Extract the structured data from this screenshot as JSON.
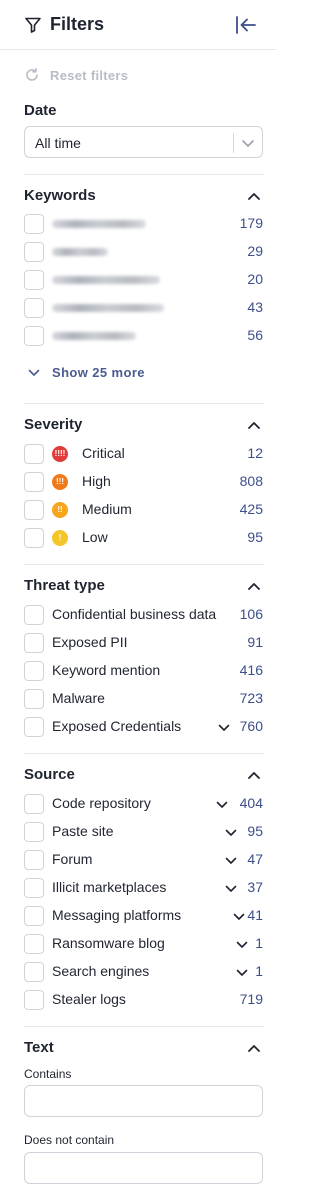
{
  "header": {
    "title": "Filters",
    "filter_icon": "filter-icon",
    "collapse_icon": "collapse-left-icon"
  },
  "reset": {
    "label": "Reset filters",
    "icon": "refresh-icon"
  },
  "date": {
    "title": "Date",
    "value": "All time"
  },
  "keywords": {
    "title": "Keywords",
    "items": [
      {
        "label": "",
        "count": "179"
      },
      {
        "label": "",
        "count": "29"
      },
      {
        "label": "",
        "count": "20"
      },
      {
        "label": "",
        "count": "43"
      },
      {
        "label": "",
        "count": "56"
      }
    ],
    "show_more": "Show 25 more"
  },
  "severity": {
    "title": "Severity",
    "items": [
      {
        "label": "Critical",
        "count": "12",
        "color": "#e23b3b",
        "icon": "!!!!"
      },
      {
        "label": "High",
        "count": "808",
        "color": "#f07a1a",
        "icon": "!!!"
      },
      {
        "label": "Medium",
        "count": "425",
        "color": "#f6a51c",
        "icon": "!!"
      },
      {
        "label": "Low",
        "count": "95",
        "color": "#f5c62a",
        "icon": "!"
      }
    ]
  },
  "threat_type": {
    "title": "Threat type",
    "items": [
      {
        "label": "Confidential business data",
        "count": "106"
      },
      {
        "label": "Exposed PII",
        "count": "91"
      },
      {
        "label": "Keyword mention",
        "count": "416"
      },
      {
        "label": "Malware",
        "count": "723"
      },
      {
        "label": "Exposed Credentials",
        "count": "760"
      }
    ]
  },
  "source": {
    "title": "Source",
    "items": [
      {
        "label": "Code repository",
        "count": "404"
      },
      {
        "label": "Paste site",
        "count": "95"
      },
      {
        "label": "Forum",
        "count": "47"
      },
      {
        "label": "Illicit marketplaces",
        "count": "37"
      },
      {
        "label": "Messaging platforms",
        "count": "41"
      },
      {
        "label": "Ransomware blog",
        "count": "1"
      },
      {
        "label": "Search engines",
        "count": "1"
      },
      {
        "label": "Stealer logs",
        "count": "719"
      }
    ]
  },
  "text": {
    "title": "Text",
    "contains_label": "Contains",
    "not_contains_label": "Does not contain"
  },
  "colors": {
    "accent": "#3d4f8c",
    "muted": "#b9bcc6",
    "border": "#cfd3da"
  }
}
